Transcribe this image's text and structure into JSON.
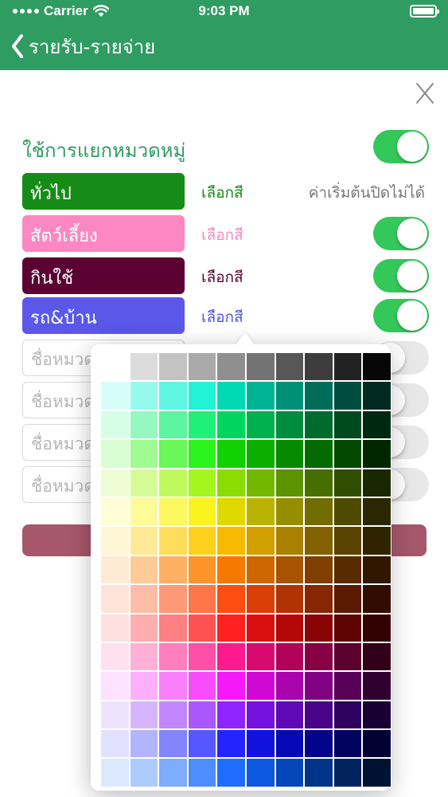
{
  "status_bar": {
    "carrier": "Carrier",
    "time": "9:03 PM"
  },
  "nav": {
    "back_title": "รายรับ-รายจ่าย"
  },
  "header": {
    "label": "ใช้การแยกหมวดหมู่",
    "switch_on": true
  },
  "categories": [
    {
      "name": "ทั่วไป",
      "color": "#168b17",
      "pick_label": "เลือกสี",
      "pick_color": "#168b17",
      "note": "ค่าเริ่มต้นปิดไม่ได้",
      "switch": null
    },
    {
      "name": "สัตว์เลี้ยง",
      "color": "#fc87c2",
      "pick_label": "เลือกสี",
      "pick_color": "#f18ac0",
      "note": "",
      "switch": true
    },
    {
      "name": "กินใช้",
      "color": "#5c0233",
      "pick_label": "เลือกสี",
      "pick_color": "#5c0233",
      "note": "",
      "switch": true
    },
    {
      "name": "รถ&บ้าน",
      "color": "#5a57e9",
      "pick_label": "เลือกสี",
      "pick_color": "#4f55d6",
      "note": "",
      "switch": true
    },
    {
      "placeholder": "ชื่อหมวด",
      "switch": false
    },
    {
      "placeholder": "ชื่อหมวด",
      "switch": false
    },
    {
      "placeholder": "ชื่อหมวด",
      "switch": false
    },
    {
      "placeholder": "ชื่อหมวด",
      "switch": false
    }
  ],
  "colors": {
    "brand_green": "#2f9c62",
    "switch_on": "#34c759",
    "save_bar": "#a6576b"
  },
  "icons": {
    "back": "chevron-left-icon",
    "close": "close-x-icon",
    "wifi": "wifi-icon",
    "battery": "battery-icon"
  },
  "palette": [
    [
      "#ffffff",
      "#dcdcdc",
      "#c3c3c3",
      "#aaaaaa",
      "#8f8f8f",
      "#737373",
      "#575757",
      "#3d3d3d",
      "#222222",
      "#070707"
    ],
    [
      "#d7fdf9",
      "#96f9ec",
      "#5ef6e0",
      "#20f3d6",
      "#00d9b4",
      "#00b394",
      "#009077",
      "#006d5a",
      "#004d40",
      "#002a22"
    ],
    [
      "#d6fde5",
      "#95f8c0",
      "#5cf49e",
      "#1ff07a",
      "#00d65f",
      "#00b14e",
      "#008c3e",
      "#006b2f",
      "#004a20",
      "#002810"
    ],
    [
      "#d8fdd3",
      "#9ffb92",
      "#69f75a",
      "#2bf31d",
      "#12d100",
      "#0caf00",
      "#078a00",
      "#056a00",
      "#034900",
      "#012700"
    ],
    [
      "#eefdd4",
      "#d4fb96",
      "#befa5e",
      "#a5f61f",
      "#8bdc00",
      "#73b800",
      "#5c9300",
      "#476f00",
      "#314d00",
      "#192800"
    ],
    [
      "#fefdd6",
      "#fcfb96",
      "#fbf75f",
      "#fbf31f",
      "#dfd900",
      "#bab400",
      "#958f00",
      "#716d00",
      "#4e4b00",
      "#2a2800"
    ],
    [
      "#fef6d5",
      "#feea96",
      "#fedd5d",
      "#fed11f",
      "#f6bb00",
      "#d19f00",
      "#aa8000",
      "#826100",
      "#5a4300",
      "#302300"
    ],
    [
      "#feead5",
      "#fecb97",
      "#fdb062",
      "#fd942a",
      "#f47a00",
      "#cf6700",
      "#a85300",
      "#803f00",
      "#582b00",
      "#2f1700"
    ],
    [
      "#fee3d9",
      "#febda6",
      "#fe9977",
      "#fe7548",
      "#fc4e10",
      "#d93f06",
      "#b13203",
      "#862602",
      "#5c1901",
      "#310c00"
    ],
    [
      "#fee0e0",
      "#feaeae",
      "#fe8080",
      "#fe5252",
      "#fe2121",
      "#da1010",
      "#b40707",
      "#890404",
      "#5e0202",
      "#320000"
    ],
    [
      "#ffe0ef",
      "#ffb0d6",
      "#ff7fbe",
      "#ff4fa6",
      "#fe1a8c",
      "#d8096f",
      "#b10359",
      "#860143",
      "#5c002e",
      "#310018"
    ],
    [
      "#fde1fe",
      "#fbaffd",
      "#f97efc",
      "#f84cfb",
      "#f518f9",
      "#d008d4",
      "#a904ad",
      "#810183",
      "#58005a",
      "#2f0030"
    ],
    [
      "#eee3fe",
      "#d7b5fe",
      "#c186fe",
      "#aa57fe",
      "#9024fe",
      "#7612df",
      "#5e08b6",
      "#47048a",
      "#30025f",
      "#190032"
    ],
    [
      "#e1e1fe",
      "#b3b4fe",
      "#8384fe",
      "#5657fe",
      "#2324fe",
      "#1212df",
      "#0808b6",
      "#04048a",
      "#02025f",
      "#000032"
    ],
    [
      "#dce8fe",
      "#aecbfe",
      "#7eacfe",
      "#4f8dfe",
      "#1f6dfe",
      "#0d58e0",
      "#0546b8",
      "#023489",
      "#01235e",
      "#001232"
    ]
  ]
}
